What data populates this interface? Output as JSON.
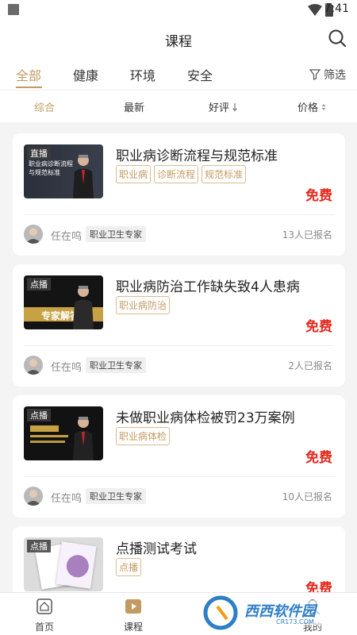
{
  "status_bar": {
    "time": "7:41"
  },
  "header": {
    "title": "课程"
  },
  "tabs": [
    {
      "label": "全部"
    },
    {
      "label": "健康"
    },
    {
      "label": "环境"
    },
    {
      "label": "安全"
    }
  ],
  "filter": {
    "label": "筛选"
  },
  "sort": {
    "options": [
      {
        "label": "综合"
      },
      {
        "label": "最新"
      },
      {
        "label": "好评"
      },
      {
        "label": "价格"
      }
    ]
  },
  "courses": [
    {
      "type_badge": "直播",
      "thumb_line1": "职业病诊断流程",
      "thumb_line2": "与规范标准",
      "title": "职业病诊断流程与规范标准",
      "tags": [
        "职业病",
        "诊断流程",
        "规范标准"
      ],
      "price": "免费",
      "author": "任在呜",
      "role": "职业卫生专家",
      "signups": "13人已报名"
    },
    {
      "type_badge": "点播",
      "thumb_banner": "专家解答",
      "title": "职业病防治工作缺失致4人患病",
      "tags": [
        "职业病防治"
      ],
      "price": "免费",
      "author": "任在呜",
      "role": "职业卫生专家",
      "signups": "2人已报名"
    },
    {
      "type_badge": "点播",
      "title": "未做职业病体检被罚23万案例",
      "tags": [
        "职业病体检"
      ],
      "price": "免费",
      "author": "任在呜",
      "role": "职业卫生专家",
      "signups": "10人已报名"
    },
    {
      "type_badge": "点播",
      "title": "点播测试考试",
      "tags": [
        "点播"
      ],
      "price": "免费"
    }
  ],
  "bottom_nav": [
    {
      "label": "首页",
      "icon": "home-icon"
    },
    {
      "label": "课程",
      "icon": "video-icon"
    },
    {
      "label": "我的",
      "icon": "user-icon"
    }
  ],
  "watermark": {
    "text": "西西软件园",
    "sub": "CR173.COM"
  },
  "colors": {
    "accent": "#c49a63",
    "price": "#e4261b",
    "background": "#f4f4f4"
  }
}
